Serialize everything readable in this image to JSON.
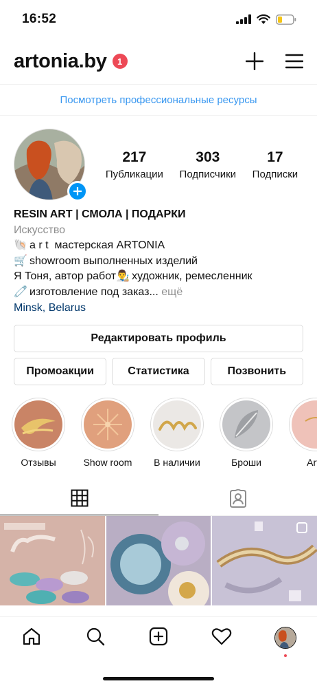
{
  "status_bar": {
    "time": "16:52"
  },
  "header": {
    "username": "artonia.by",
    "notification_count": "1"
  },
  "professional_banner": {
    "text": "Посмотреть профессиональные ресурсы"
  },
  "stats": [
    {
      "value": "217",
      "label": "Публикации"
    },
    {
      "value": "303",
      "label": "Подписчики"
    },
    {
      "value": "17",
      "label": "Подписки"
    }
  ],
  "bio": {
    "name": "RESIN ART | СМОЛА | ПОДАРКИ",
    "category": "Искусство",
    "line1_emoji": "🐚",
    "line1": "a r t  мастерская ARTONIA",
    "line2_emoji": "🛒",
    "line2": "showroom выполненных изделий",
    "line3_start": "Я Тоня, автор работ",
    "line3_emoji": "👨‍🎨",
    "line3_end": "художник, ремесленник",
    "line4_emoji": "🧷",
    "line4": "изготовление под заказ...",
    "more": "ещё",
    "location_city": "Minsk",
    "location_sep": ",",
    "location_country": "Belarus"
  },
  "buttons": {
    "edit_profile": "Редактировать профиль",
    "promotions": "Промоакции",
    "insights": "Статистика",
    "call": "Позвонить"
  },
  "highlights": [
    {
      "label": "Отзывы",
      "color": "#d08b6d"
    },
    {
      "label": "Show room",
      "color": "#e2a07c"
    },
    {
      "label": "В наличии",
      "color": "#e8e6e4"
    },
    {
      "label": "Броши",
      "color": "#c9c9cb"
    },
    {
      "label": "Arto",
      "color": "#e9b9b2"
    }
  ],
  "tabs": {
    "active": "grid"
  },
  "colors": {
    "accent": "#0095f6",
    "link": "#3897f0",
    "badge": "#ed4956",
    "location": "#00376b"
  }
}
